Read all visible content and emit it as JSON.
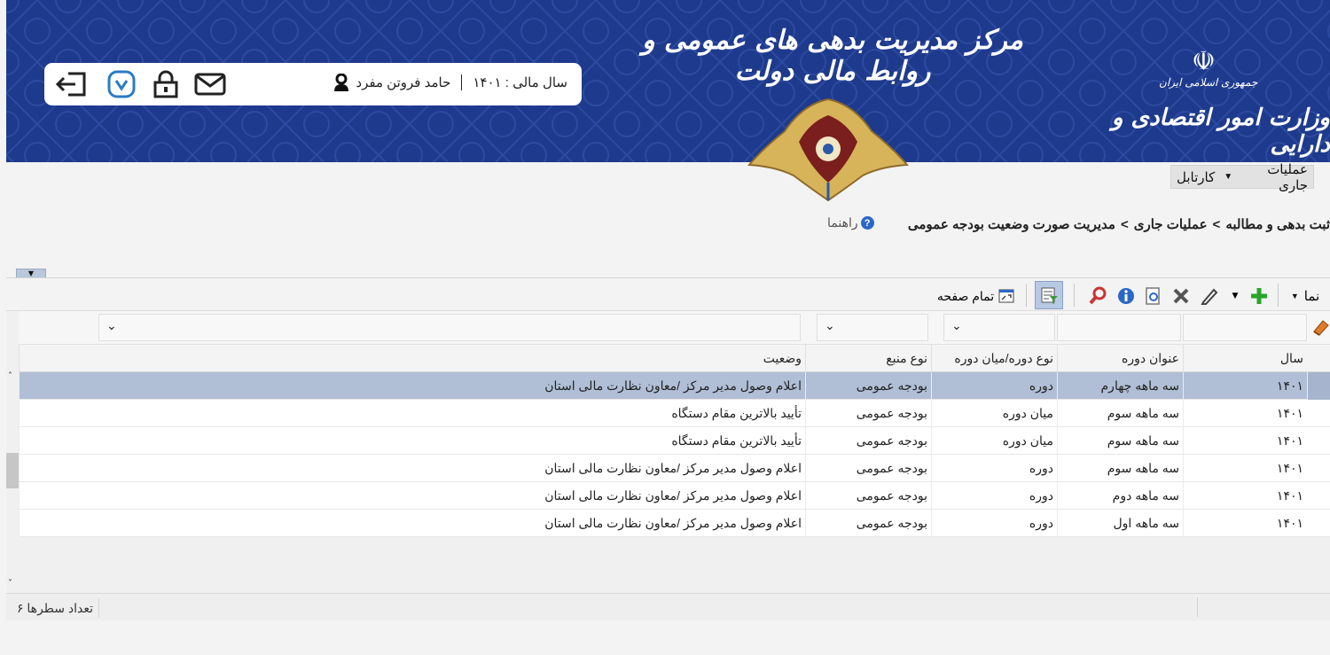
{
  "header": {
    "center_title": "مرکز مدیریت بدهی های عمومی و روابط مالی دولت",
    "gov_label": "جمهوری اسلامی ایران",
    "ministry": "وزارت امور اقتصادی و دارایی",
    "brand_color": "#1e3a8c",
    "user": {
      "name": "حامد فروتن مفرد",
      "fiscal_year": "سال مالی : ۱۴۰۱",
      "icons": [
        "exit-icon",
        "v-badge-icon",
        "lock-icon",
        "mail-icon",
        "user-icon"
      ]
    }
  },
  "tabs": {
    "current": "عملیات جاری",
    "other": "کارتابل"
  },
  "breadcrumb": {
    "items": [
      "ثبت بدهی و مطالبه",
      "عملیات جاری",
      "مدیریت صورت وضعیت بودجه عمومی"
    ],
    "separator": ">",
    "help_label": "راهنما"
  },
  "toolbar": {
    "view_label": "نما",
    "full_page_label": "تمام صفحه"
  },
  "table": {
    "columns": [
      "سال",
      "عنوان دوره",
      "نوع دوره/میان دوره",
      "نوع منبع",
      "وضعیت"
    ],
    "rows": [
      [
        "۱۴۰۱",
        "سه ماهه چهارم",
        "دوره",
        "بودجه عمومی",
        "اعلام وصول مدیر مرکز /معاون نظارت مالی استان"
      ],
      [
        "۱۴۰۱",
        "سه ماهه سوم",
        "میان دوره",
        "بودجه عمومی",
        "تأیید بالاترین مقام دستگاه"
      ],
      [
        "۱۴۰۱",
        "سه ماهه سوم",
        "میان دوره",
        "بودجه عمومی",
        "تأیید بالاترین مقام دستگاه"
      ],
      [
        "۱۴۰۱",
        "سه ماهه سوم",
        "دوره",
        "بودجه عمومی",
        "اعلام وصول مدیر مرکز /معاون نظارت مالی استان"
      ],
      [
        "۱۴۰۱",
        "سه ماهه دوم",
        "دوره",
        "بودجه عمومی",
        "اعلام وصول مدیر مرکز /معاون نظارت مالی استان"
      ],
      [
        "۱۴۰۱",
        "سه ماهه اول",
        "دوره",
        "بودجه عمومی",
        "اعلام وصول مدیر مرکز /معاون نظارت مالی استان"
      ]
    ],
    "selected_row": 0
  },
  "footer": {
    "row_count": "تعداد سطرها ۶"
  }
}
